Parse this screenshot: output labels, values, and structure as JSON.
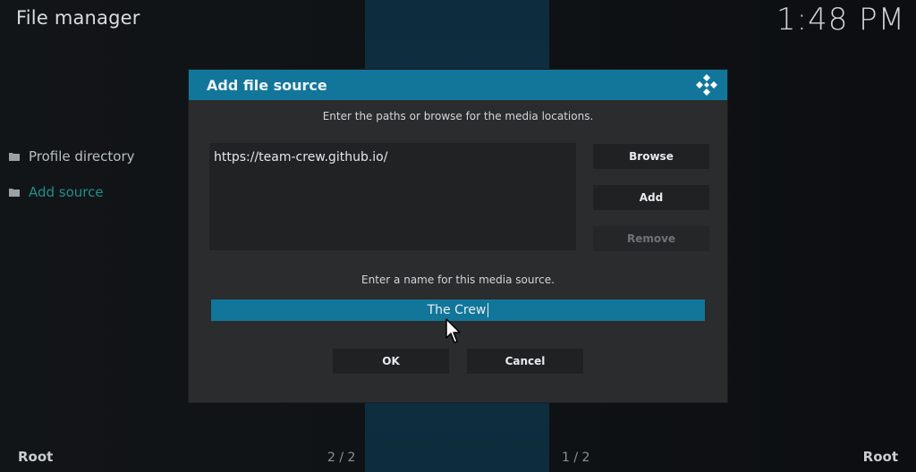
{
  "app": {
    "title": "File manager",
    "clock": "1:48 PM"
  },
  "sidebar": {
    "items": [
      {
        "label": "Profile directory",
        "icon": "folder-icon"
      },
      {
        "label": "Add source",
        "icon": "folder-icon"
      }
    ]
  },
  "footer": {
    "left_label": "Root",
    "left_page": "2 / 2",
    "right_page": "1 / 2",
    "right_label": "Root"
  },
  "dialog": {
    "title": "Add file source",
    "logo_icon": "kodi-logo-icon",
    "paths_instruction": "Enter the paths or browse for the media locations.",
    "paths": [
      "https://team-crew.github.io/"
    ],
    "buttons": {
      "browse": "Browse",
      "add": "Add",
      "remove": "Remove"
    },
    "name_instruction": "Enter a name for this media source.",
    "name_value": "The Crew",
    "ok": "OK",
    "cancel": "Cancel"
  },
  "colors": {
    "accent": "#12769a",
    "active_item": "#1f8f8a",
    "dialog_bg": "#2a2c2e"
  }
}
